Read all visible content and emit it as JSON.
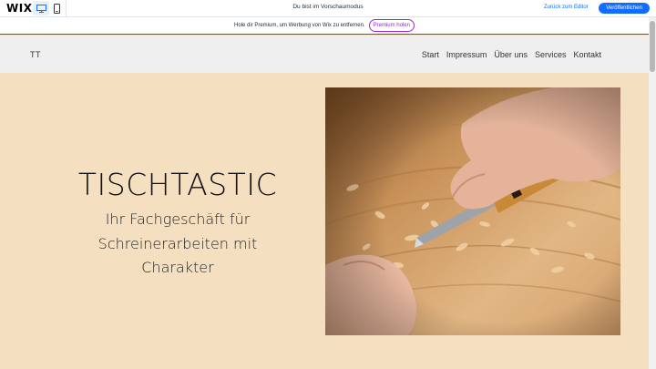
{
  "editor": {
    "logo": "WIX",
    "preview_text": "Du bist im Vorschaumodus",
    "back_link": "Zurück zum Editor",
    "publish_label": "Veröffentlichen"
  },
  "premium": {
    "text": "Hole dir Premium, um Werbung von Wix zu entfernen.",
    "button_label": "Premium holen"
  },
  "site": {
    "logo": "TT",
    "nav": [
      "Start",
      "Impressum",
      "Über uns",
      "Services",
      "Kontakt"
    ]
  },
  "hero": {
    "title": "TISCHTASTIC",
    "subtitle": "Ihr Fachgeschäft für Schreinerarbeiten mit Charakter"
  },
  "colors": {
    "accent": "#116dff",
    "premium": "#9a27d5",
    "hero_background": "#f5dfc1"
  }
}
